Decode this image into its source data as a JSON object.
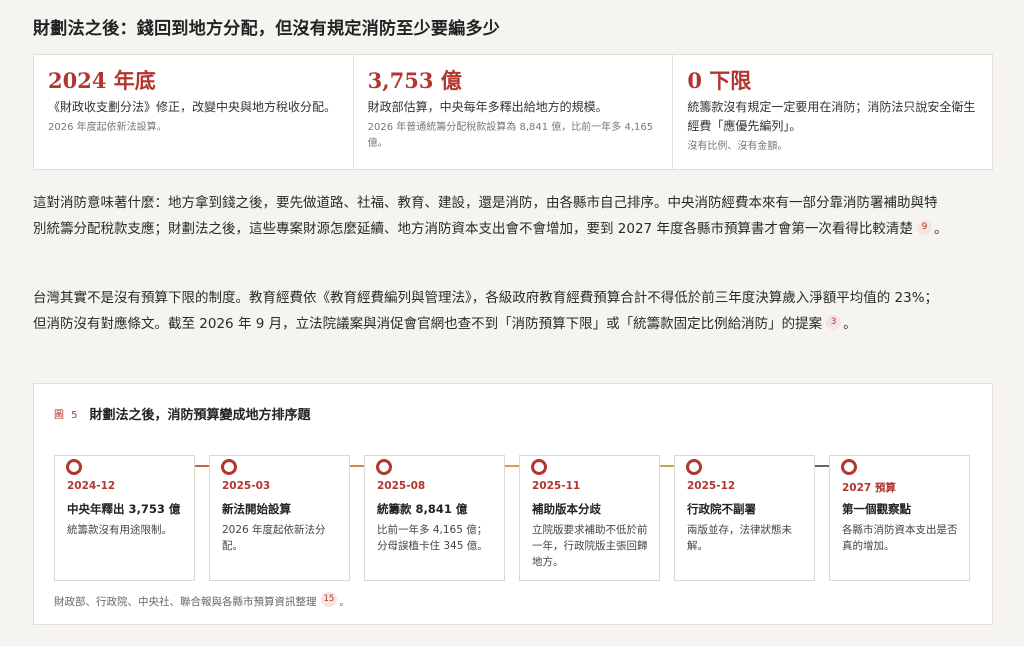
{
  "header": {
    "title": "財劃法之後：錢回到地方分配，但沒有規定消防至少要編多少"
  },
  "stats": [
    {
      "value": "2024 年底",
      "desc": "《財政收支劃分法》修正，改變中央與地方稅收分配。",
      "note": "2026 年度起依新法設算。"
    },
    {
      "value": "3,753 億",
      "desc": "財政部估算，中央每年多釋出給地方的規模。",
      "note": "2026 年普通統籌分配稅款設算為 8,841 億，比前一年多 4,165 億。"
    },
    {
      "value": "0 下限",
      "desc": "統籌款沒有規定一定要用在消防；消防法只說安全衛生經費「應優先編列」。",
      "note": "沒有比例、沒有金額。"
    }
  ],
  "paragraphs": [
    {
      "text": "這對消防意味著什麼：地方拿到錢之後，要先做道路、社福、教育、建設，還是消防，由各縣市自己排序。中央消防經費本來有一部分靠消防署補助與特別統籌分配稅款支應；財劃法之後，這些專案財源怎麼延續、地方消防資本支出會不會增加，要到 2027 年度各縣市預算書才會第一次看得比較清楚",
      "fn": "9",
      "end": "。"
    },
    {
      "text": "台灣其實不是沒有預算下限的制度。教育經費依《教育經費編列與管理法》，各級政府教育經費預算合計不得低於前三年度決算歲入淨額平均值的 23%；但消防沒有對應條文。截至 2026 年 9 月，立法院議案與消促會官網也查不到「消防預算下限」或「統籌款固定比例給消防」的提案",
      "fn": "3",
      "end": "。"
    }
  ],
  "figure": {
    "label": "圖 5",
    "title": "財劃法之後，消防預算變成地方排序題",
    "connector_colors": [
      "#c9603f",
      "#d48a3a",
      "#d9a047",
      "#c9a24a",
      "#666666"
    ],
    "items": [
      {
        "date": "2024-12",
        "title": "中央年釋出 3,753 億",
        "desc": "統籌款沒有用途限制。"
      },
      {
        "date": "2025-03",
        "title": "新法開始設算",
        "desc": "2026 年度起依新法分配。"
      },
      {
        "date": "2025-08",
        "title": "統籌款 8,841 億",
        "desc": "比前一年多 4,165 億；分母誤植卡住 345 億。"
      },
      {
        "date": "2025-11",
        "title": "補助版本分歧",
        "desc": "立院版要求補助不低於前一年，行政院版主張回歸地方。"
      },
      {
        "date": "2025-12",
        "title": "行政院不副署",
        "desc": "兩版並存，法律狀態未解。"
      },
      {
        "date": "2027 預算",
        "title": "第一個觀察點",
        "desc": "各縣市消防資本支出是否真的增加。"
      }
    ],
    "source": {
      "text": "財政部、行政院、中央社、聯合報與各縣市預算資訊整理",
      "fn": "15",
      "end": "。"
    }
  }
}
